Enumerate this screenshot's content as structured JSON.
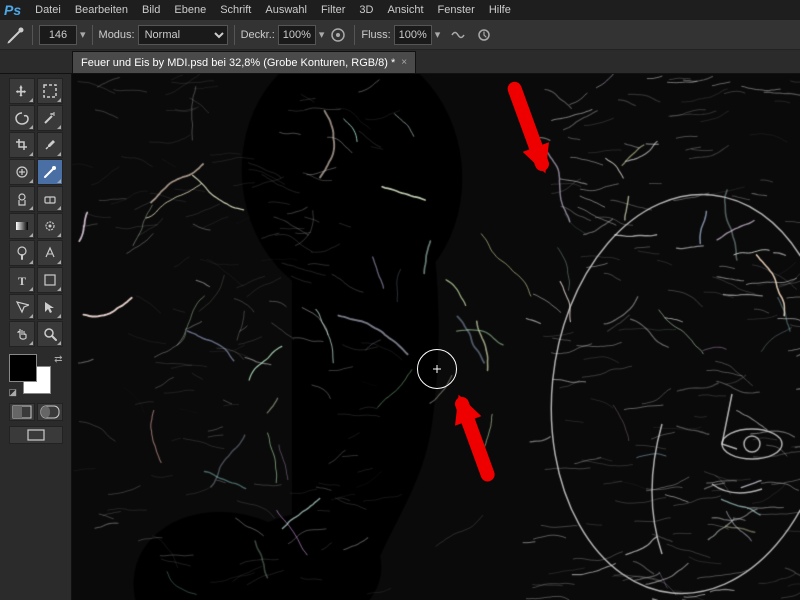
{
  "app": {
    "logo": "Ps",
    "menu_items": [
      "Datei",
      "Bearbeiten",
      "Bild",
      "Ebene",
      "Schrift",
      "Auswahl",
      "Filter",
      "3D",
      "Ansicht",
      "Fenster",
      "Hilfe"
    ]
  },
  "toolbar": {
    "brush_size": "146",
    "mode_label": "Modus:",
    "mode_value": "Normal",
    "opacity_label": "Deckr.:",
    "opacity_value": "100%",
    "flow_label": "Fluss:",
    "flow_value": "100%"
  },
  "tab": {
    "title": "Feuer und Eis by MDI.psd bei 32,8% (Grobe Konturen, RGB/8) *",
    "close": "×"
  },
  "tools": {
    "rows": [
      [
        "✥",
        "⊹"
      ],
      [
        "▭",
        "⬡"
      ],
      [
        "✂",
        "✦"
      ],
      [
        "⊘",
        "✑"
      ],
      [
        "✏",
        "✒"
      ],
      [
        "⚟",
        "⊡"
      ],
      [
        "✍",
        "⊘"
      ],
      [
        "⌧",
        "⊡"
      ],
      [
        "T",
        "⊡"
      ],
      [
        "↖",
        "⊹"
      ],
      [
        "✋",
        "🔍"
      ]
    ]
  }
}
